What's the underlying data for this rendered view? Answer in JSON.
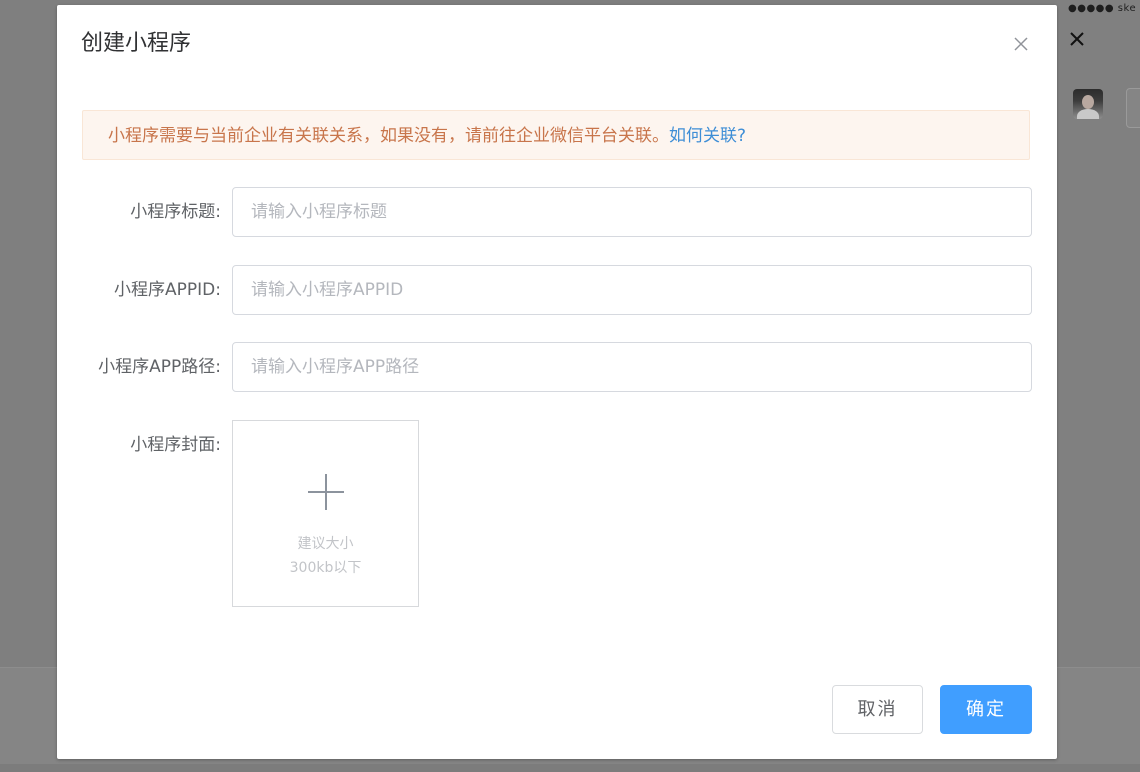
{
  "background": {
    "status_text": "●●●●● ske",
    "close_icon": "close-icon",
    "overlay_color": "#7f7f7f"
  },
  "dialog": {
    "title": "创建小程序",
    "close_icon": "close-icon",
    "alert": {
      "text": "小程序需要与当前企业有关联关系，如果没有，请前往企业微信平台关联。",
      "link_text": "如何关联?",
      "text_color": "#c8754b",
      "link_color": "#3e8ed6",
      "background_color": "#fdf5ef"
    },
    "form": {
      "title_label": "小程序标题:",
      "title_placeholder": "请输入小程序标题",
      "title_value": "",
      "appid_label": "小程序APPID:",
      "appid_placeholder": "请输入小程序APPID",
      "appid_value": "",
      "path_label": "小程序APP路径:",
      "path_placeholder": "请输入小程序APP路径",
      "path_value": "",
      "cover_label": "小程序封面:",
      "cover_upload": {
        "icon": "plus-icon",
        "hint_line1": "建议大小",
        "hint_line2": "300kb以下"
      }
    },
    "footer": {
      "cancel_label": "取消",
      "ok_label": "确定",
      "primary_color": "#409eff"
    }
  }
}
